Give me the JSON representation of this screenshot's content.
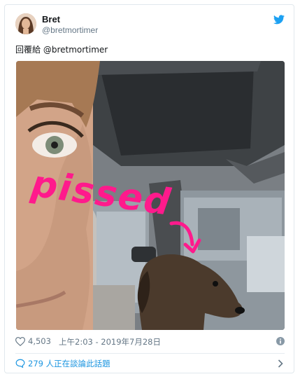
{
  "tweet": {
    "author_name": "Bret",
    "author_handle": "@bretmortimer",
    "reply_prefix": "回覆給",
    "reply_to": "@bretmortimer",
    "photo_caption": "pissed",
    "likes": "4,503",
    "timestamp": "上午2:03 - 2019年7月28日",
    "conversation": "279 人正在談論此話題"
  },
  "icons": {
    "brand": "twitter-bird-icon",
    "like": "heart-icon",
    "info": "info-icon",
    "conversation": "speech-bubble-icon",
    "chevron": "chevron-right-icon"
  },
  "colors": {
    "brand_blue": "#1da1f2",
    "caption_pink": "#ff1a8c",
    "link_blue": "#1b95e0",
    "muted": "#657786"
  }
}
